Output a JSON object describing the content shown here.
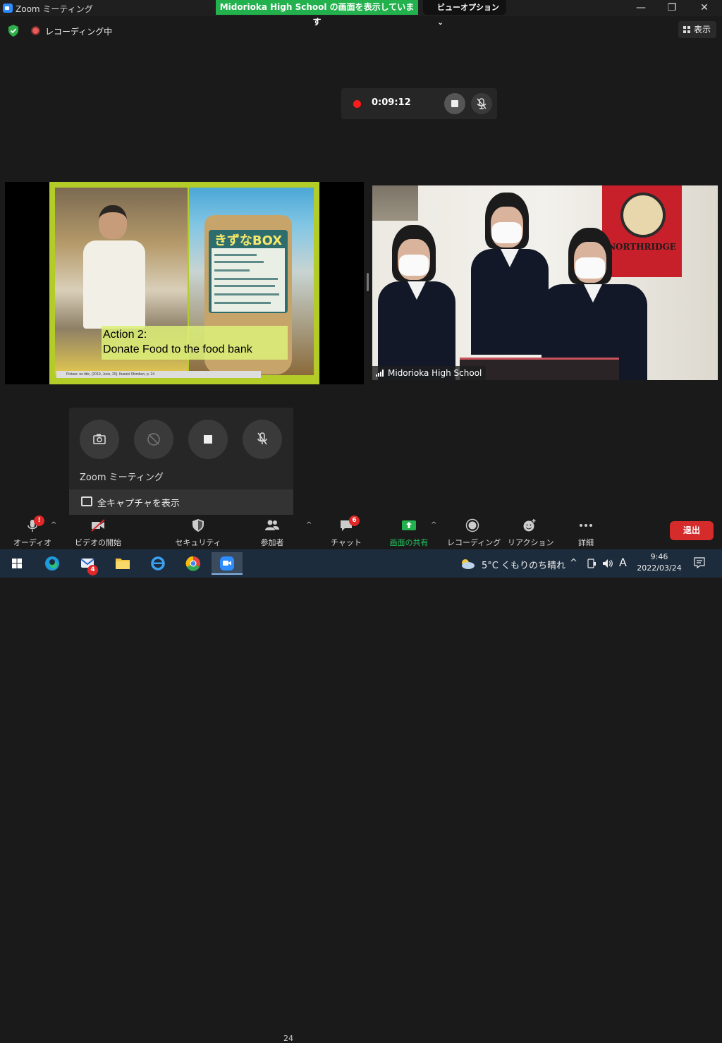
{
  "window": {
    "title": "Zoom ミーティング",
    "share_banner": "Midorioka  High  School の画面を表示しています",
    "view_options": "ビューオプション ⌄"
  },
  "header": {
    "recording_label": "レコーディング中",
    "view_button": "表示"
  },
  "recording_panel": {
    "timer": "0:09:12"
  },
  "slide": {
    "can_title": "きずなBOX",
    "caption_line1": "Action 2:",
    "caption_line2": "Donate Food to the food bank",
    "credit": "Picture: no title, (2019, June, 25). Ibaraki Shimbun, p. 24"
  },
  "camera": {
    "banner_text": "NORTHRIDGE",
    "participant_name": "Midorioka High School"
  },
  "capture_panel": {
    "title": "Zoom ミーティング",
    "captions_label": "全キャプチャを表示"
  },
  "toolbar": {
    "audio": "オーディオ",
    "video": "ビデオの開始",
    "security": "セキュリティ",
    "participants": "参加者",
    "participants_count": "24",
    "chat": "チャット",
    "chat_badge": "6",
    "share": "画面の共有",
    "record": "レコーディング",
    "reactions": "リアクション",
    "more": "詳細",
    "leave": "退出",
    "audio_badge": "!"
  },
  "taskbar": {
    "mail_badge": "4",
    "weather": "5°C  くもりのち晴れ",
    "ime": "A",
    "time": "9:46",
    "date": "2022/03/24"
  },
  "colors": {
    "share_green": "#22b14c",
    "leave_red": "#d52b2b",
    "record_red": "#ff1a1a"
  }
}
